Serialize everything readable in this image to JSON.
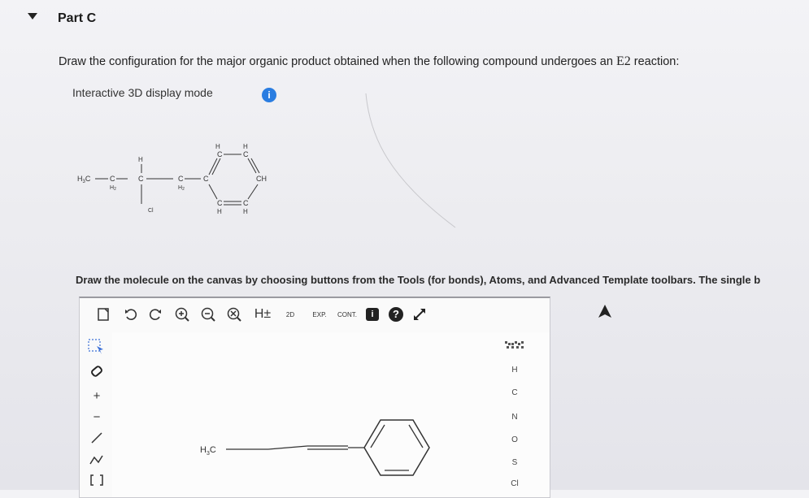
{
  "part": {
    "title": "Part C"
  },
  "question": {
    "text_before": "Draw the configuration for the major organic product obtained when the following compound undergoes an ",
    "reaction_type": "E2",
    "text_after": " reaction:"
  },
  "display_mode": {
    "label": "Interactive 3D display mode",
    "info": "i"
  },
  "instruction": "Draw the molecule on the canvas by choosing buttons from the Tools (for bonds), Atoms, and Advanced Template toolbars. The single b",
  "reactant_labels": {
    "h3c": "H",
    "h3c_sub": "3",
    "c": "C",
    "ch": "CH",
    "h": "H",
    "h2": "H",
    "h2_sub": "2",
    "cl": "Cl"
  },
  "toolbar": {
    "h_plus": "H±",
    "two_d": "2D",
    "exp": "EXP.",
    "cont": "CONT.",
    "help": "?",
    "info": "i"
  },
  "left_tools": {
    "plus": "+",
    "minus": "−"
  },
  "canvas": {
    "methyl_label": "H",
    "methyl_sub": "3",
    "methyl_c": "C"
  },
  "atoms": [
    "H",
    "C",
    "N",
    "O",
    "S",
    "Cl"
  ]
}
